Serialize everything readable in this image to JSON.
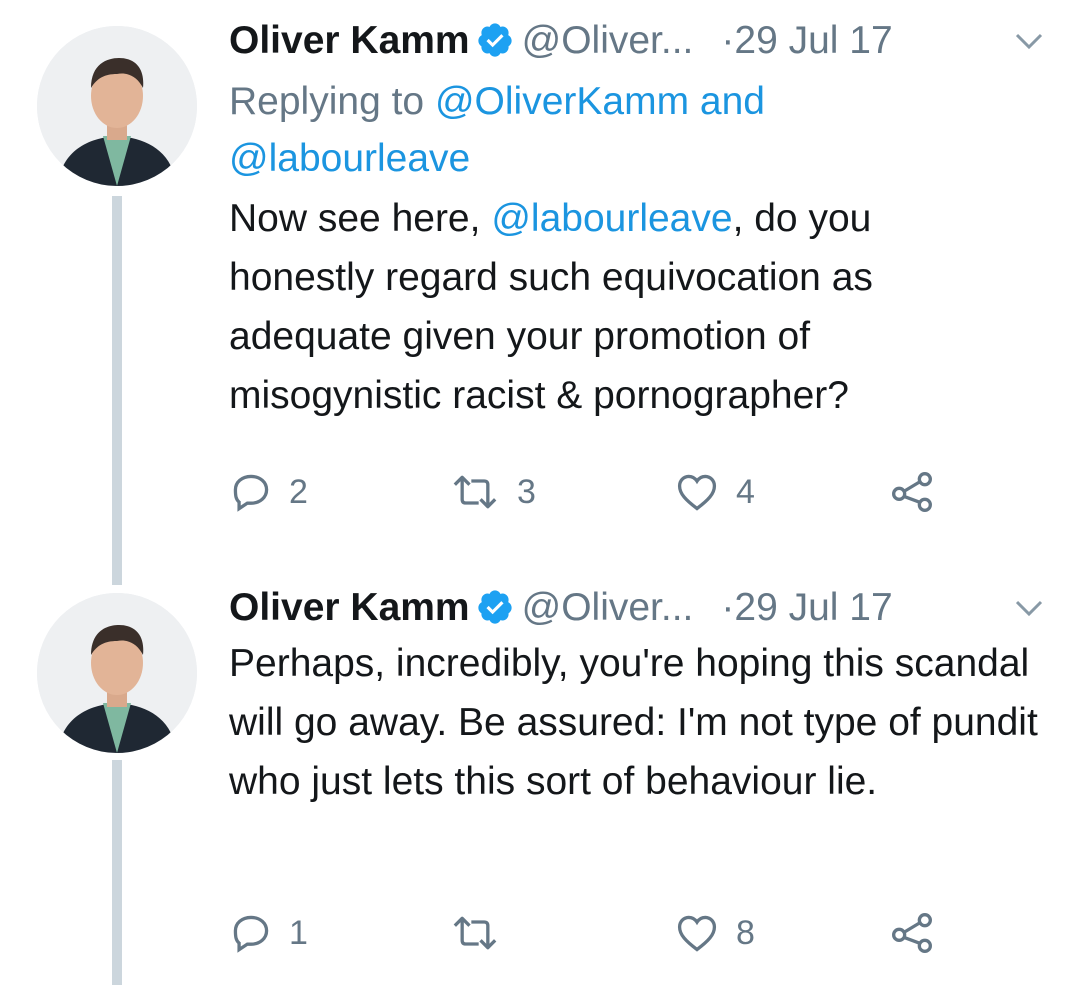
{
  "tweets": [
    {
      "name": "Oliver Kamm",
      "handle": "@Oliver...",
      "separator": "·",
      "time": "29 Jul 17",
      "replying_prefix": "Replying to ",
      "replying_user1": "@OliverKamm",
      "replying_and": " and",
      "replying_user2": "@labourleave",
      "text_before": "Now see here, ",
      "text_mention": "@labourleave",
      "text_after": ", do you honestly regard such equivocation as adequate given your promotion of misogynistic racist & pornographer?",
      "reply_count": "2",
      "retweet_count": "3",
      "like_count": "4"
    },
    {
      "name": "Oliver Kamm",
      "handle": "@Oliver...",
      "separator": "·",
      "time": "29 Jul 17",
      "text": "Perhaps, incredibly, you're hoping this scandal will go away. Be assured: I'm not type of pundit who just lets this sort of behaviour lie.",
      "reply_count": "1",
      "retweet_count": "",
      "like_count": "8"
    }
  ],
  "icons": {
    "verified": "verified-badge-icon",
    "caret": "chevron-down-icon",
    "reply": "reply-bubble-icon",
    "retweet": "retweet-icon",
    "like": "heart-icon",
    "share": "share-icon"
  },
  "colors": {
    "link": "#1b95e0",
    "muted": "#657786",
    "text": "#14171a",
    "thread_line": "#ccd6dd",
    "verified": "#1da1f2"
  }
}
